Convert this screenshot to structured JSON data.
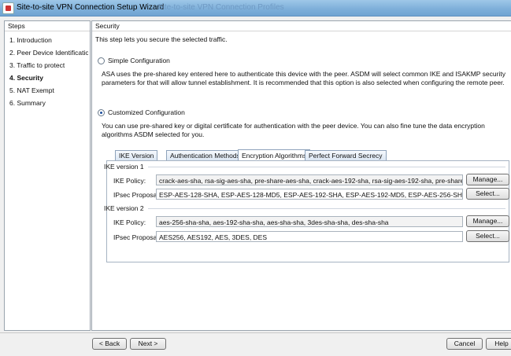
{
  "window": {
    "title": "Site-to-site VPN Connection Setup Wizard",
    "background_title": "Site-to-site VPN Connection Profiles"
  },
  "steps": {
    "header": "Steps",
    "items": [
      {
        "label": "1. Introduction"
      },
      {
        "label": "2. Peer Device Identificatio"
      },
      {
        "label": "3. Traffic to protect"
      },
      {
        "label": "4. Security"
      },
      {
        "label": "5. NAT Exempt"
      },
      {
        "label": "6. Summary"
      }
    ],
    "active_index": 3
  },
  "security": {
    "header": "Security",
    "intro": "This step lets you secure the selected traffic.",
    "simple": {
      "label": "Simple Configuration",
      "selected": false,
      "description": "ASA uses the pre-shared key entered here to authenticate this device with the peer. ASDM will select common IKE and ISAKMP security parameters for that will allow tunnel establishment. It is recommended that this option is also selected when configuring the remote peer."
    },
    "custom": {
      "label": "Customized Configuration",
      "selected": true,
      "description": "You can use pre-shared key or digital certificate for authentication with the peer device. You can also fine tune the data encryption algorithms ASDM selected for you."
    }
  },
  "tabs": [
    {
      "label": "IKE Version"
    },
    {
      "label": "Authentication Methods"
    },
    {
      "label": "Encryption Algorithms"
    },
    {
      "label": "Perfect Forward Secrecy"
    }
  ],
  "active_tab": "Encryption Algorithms",
  "ike_v1": {
    "group_label": "IKE version 1",
    "policy_label": "IKE Policy:",
    "policy_value": "crack-aes-sha, rsa-sig-aes-sha, pre-share-aes-sha, crack-aes-192-sha, rsa-sig-aes-192-sha, pre-share-aes-192-",
    "policy_button": "Manage...",
    "ipsec_label": "IPsec Proposal:",
    "ipsec_value": "ESP-AES-128-SHA, ESP-AES-128-MD5, ESP-AES-192-SHA, ESP-AES-192-MD5, ESP-AES-256-SHA, ESP-AES-256-M",
    "ipsec_button": "Select..."
  },
  "ike_v2": {
    "group_label": "IKE version 2",
    "policy_label": "IKE Policy:",
    "policy_value": "aes-256-sha-sha, aes-192-sha-sha, aes-sha-sha, 3des-sha-sha, des-sha-sha",
    "policy_button": "Manage...",
    "ipsec_label": "IPsec Proposal:",
    "ipsec_value": "AES256, AES192, AES, 3DES, DES",
    "ipsec_button": "Select..."
  },
  "footer": {
    "back": "< Back",
    "next": "Next >",
    "cancel": "Cancel",
    "help": "Help"
  }
}
